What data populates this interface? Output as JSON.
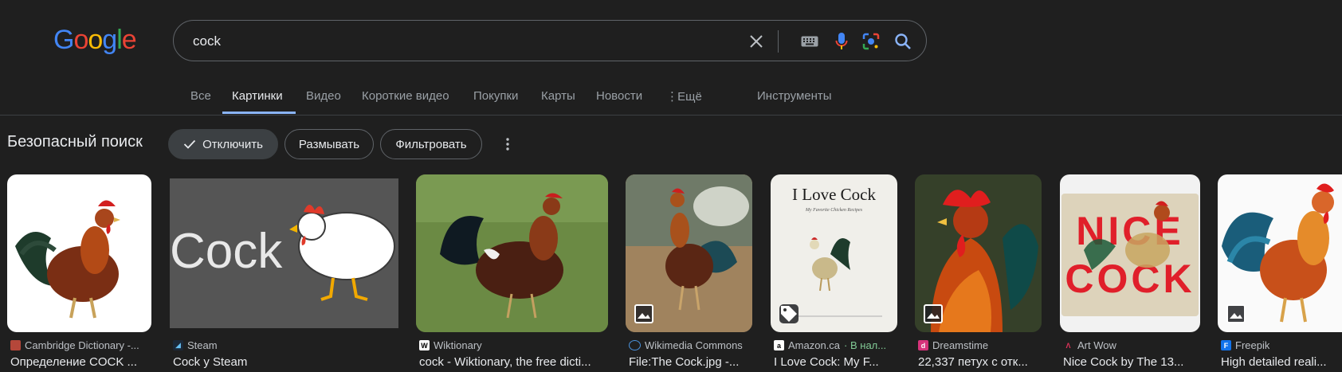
{
  "search": {
    "query": "cock"
  },
  "logo": [
    "G",
    "o",
    "o",
    "g",
    "l",
    "e"
  ],
  "tabs": [
    {
      "label": "Все"
    },
    {
      "label": "Картинки"
    },
    {
      "label": "Видео"
    },
    {
      "label": "Короткие видео"
    },
    {
      "label": "Покупки"
    },
    {
      "label": "Карты"
    },
    {
      "label": "Новости"
    },
    {
      "label": "Ещё"
    },
    {
      "label": "Инструменты"
    }
  ],
  "safe_search": {
    "title": "Безопасный поиск",
    "chips": [
      "Отключить",
      "Размывать",
      "Фильтровать"
    ]
  },
  "results": [
    {
      "source": "Cambridge Dictionary -...",
      "stock": "",
      "title": "Определение COCK ...",
      "favicon_color": "#b5473a"
    },
    {
      "source": "Steam",
      "stock": "",
      "title": "Cock у Steam",
      "favicon_color": "#1b2838"
    },
    {
      "source": "Wiktionary",
      "stock": "",
      "title": "cock - Wiktionary, the free dicti...",
      "favicon_color": "#ffffff"
    },
    {
      "source": "Wikimedia Commons",
      "stock": "",
      "title": "File:The Cock.jpg -...",
      "favicon_color": "#1f5aa6"
    },
    {
      "source": "Amazon.ca",
      "stock": "· В нал...",
      "title": "I Love Cock: My F...",
      "favicon_color": "#ffffff"
    },
    {
      "source": "Dreamstime",
      "stock": "",
      "title": "22,337 петух с отк...",
      "favicon_color": "#d6337a"
    },
    {
      "source": "Art Wow",
      "stock": "",
      "title": "Nice Cock by The 13...",
      "favicon_color": "#c0392b"
    },
    {
      "source": "Freepik",
      "stock": "",
      "title": "High detailed reali...",
      "favicon_color": "#1273eb"
    }
  ],
  "thumb_text": {
    "steam": "Cock",
    "book_title": "I Love Cock",
    "book_subtitle": "My Favorite Chicken Recipes",
    "nice_1": "NICE",
    "nice_2": "COCK"
  }
}
